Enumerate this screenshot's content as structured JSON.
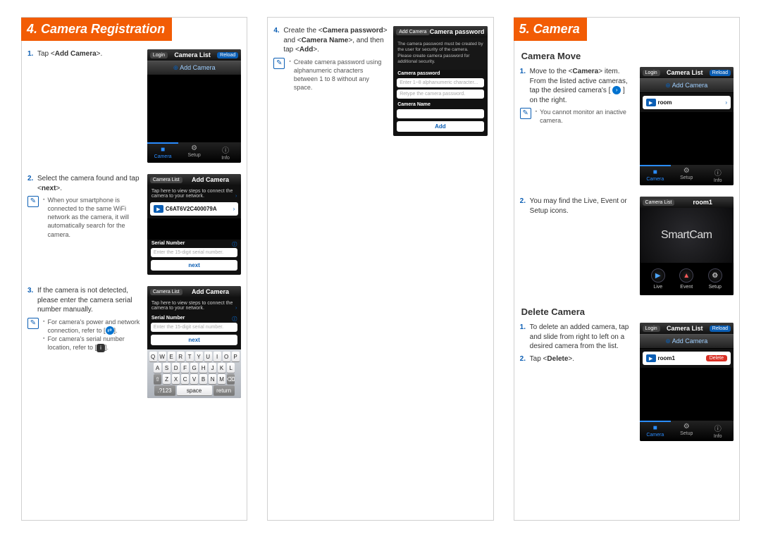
{
  "sections": {
    "s4": {
      "header": "4. Camera Registration"
    },
    "s5": {
      "header": "5. Camera"
    }
  },
  "col1": {
    "step1": {
      "num": "1.",
      "pre": "Tap <",
      "bold": "Add Camera",
      "post": ">."
    },
    "step2": {
      "num": "2.",
      "pre": "Select the camera found and tap <",
      "bold": "next",
      "post": ">."
    },
    "note2": "When your smartphone is connected to the same WiFi network as the camera, it will automatically search for the camera.",
    "step3": {
      "num": "3.",
      "txt": "If the camera is not detected, please enter the camera serial number manually."
    },
    "note3a": "For camera's power and network connection, refer to [",
    "note3a_end": "].",
    "note3b": "For camera's serial number location, refer to [",
    "note3b_end": "]."
  },
  "col2": {
    "step4": {
      "num": "4.",
      "pre": "Create the <",
      "b1": "Camera password",
      "mid1": "> and <",
      "b2": "Camera Name",
      "mid2": ">, and then tap <",
      "b3": "Add",
      "post": ">."
    },
    "note4": "Create camera password using alphanumeric characters between 1 to 8 without any space."
  },
  "col3": {
    "h_move": "Camera Move",
    "m1": {
      "num": "1.",
      "pre": "Move to the <",
      "b1": "Camera",
      "mid": "> item. From the listed active cameras, tap the desired camera's [ ",
      "post": " ] on the right."
    },
    "m_note": "You cannot monitor an inactive camera.",
    "m2": {
      "num": "2.",
      "txt": "You may find the Live, Event or Setup icons."
    },
    "h_del": "Delete Camera",
    "d1": {
      "num": "1.",
      "txt": "To delete an added camera, tap and slide from right to left on a desired camera from the list."
    },
    "d2": {
      "num": "2.",
      "pre": "Tap <",
      "b": "Delete",
      "post": ">."
    }
  },
  "phone": {
    "login": "Login",
    "camera_list": "Camera List",
    "reload": "Reload",
    "add_camera": "Add Camera",
    "tabs": {
      "camera": "Camera",
      "setup": "Setup",
      "info": "Info"
    },
    "p2": {
      "back": "Camera List",
      "title": "Add Camera",
      "subtext": "Tap here to view steps to connect the camera to your network.",
      "serial": "C6AT6V2C400079A",
      "sn_label": "Serial Number",
      "sn_placeholder": "Enter the 15-digit serial number.",
      "next": "next"
    },
    "p3": {
      "keys_r1": "QWERTYUIOP",
      "keys_r2": "ASDFGHJKL",
      "keys_r3": "ZXCVBNM",
      "k123": ".?123",
      "space": "space",
      "return": "return"
    },
    "p4": {
      "back": "Add Camera",
      "title": "Camera password",
      "hint": "The camera password must be created by the user for security of the camera. Please create camera password for additional security.",
      "label1": "Camera password",
      "ph1": "Enter 1~8 alphanumeric character...",
      "ph2": "Retype the camera password.",
      "label2": "Camera Name",
      "add": "Add"
    },
    "p5": {
      "room": "room"
    },
    "p6": {
      "back": "Camera List",
      "title": "room1",
      "logo": "SmartCam",
      "live": "Live",
      "event": "Event",
      "setup": "Setup"
    },
    "p7": {
      "room1": "room1",
      "delete": "Delete"
    }
  }
}
